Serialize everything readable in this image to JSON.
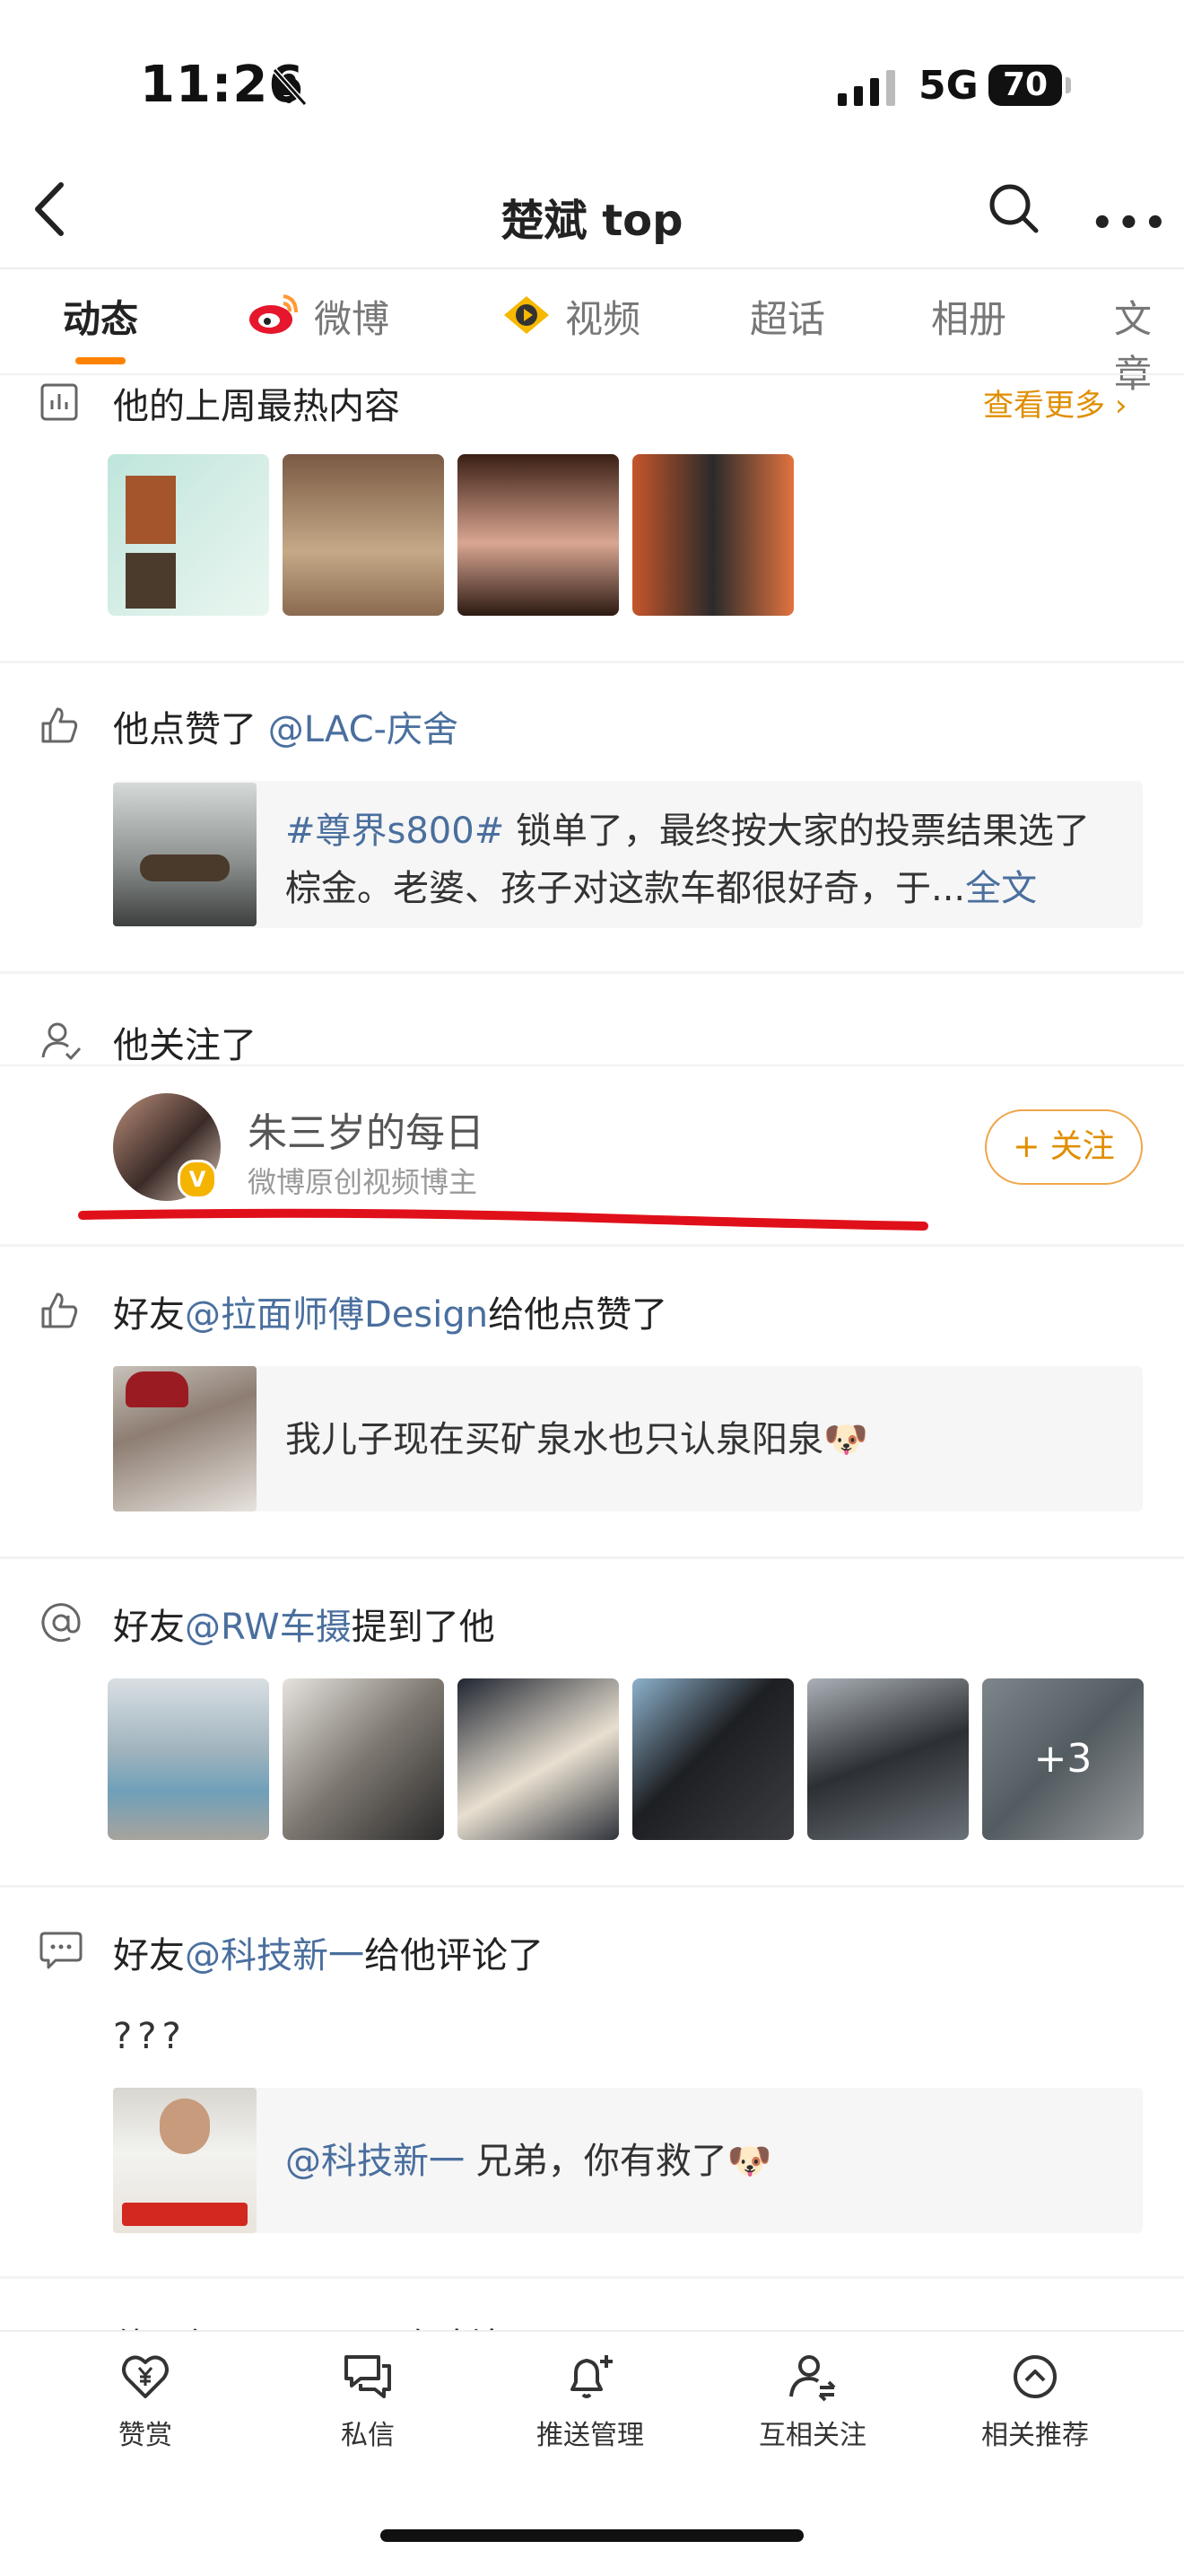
{
  "status_bar": {
    "time": "11:26",
    "network": "5G",
    "battery": "70"
  },
  "nav": {
    "title": "楚斌 top"
  },
  "tabs": [
    "动态",
    "微博",
    "视频",
    "超话",
    "相册",
    "文章"
  ],
  "weekly_hot": {
    "title": "他的上周最热内容",
    "more": "查看更多"
  },
  "like": {
    "prefix": "他点赞了",
    "user": "@LAC-庆舍",
    "tag": "#尊界s800#",
    "line1_rest": "锁单了，最终按大家的投票结果选了",
    "line2": "棕金。老婆、孩子对这款车都很好奇，于...",
    "full": "全文"
  },
  "follow": {
    "prefix": "他关注了",
    "name": "朱三岁的每日",
    "desc": "微博原创视频博主",
    "button": "+ 关注"
  },
  "friend_like": {
    "pre": "好友",
    "user": "@拉面师傅Design",
    "post": "给他点赞了",
    "text": "我儿子现在买矿泉水也只认泉阳泉",
    "emoji": "🐶"
  },
  "mention": {
    "pre": "好友",
    "user": "@RW车摄",
    "post": "提到了他",
    "more_count": "+3"
  },
  "comment": {
    "pre": "好友",
    "user": "@科技新一",
    "post": "给他评论了",
    "body": "???",
    "card_user": "@科技新一",
    "card_text": "兄弟，你有救了",
    "emoji": "🐶"
  },
  "partial_row": {
    "text": "他回复了 @LOVE玫瑰塘"
  },
  "bottom_bar": {
    "items": [
      {
        "label": "赞赏",
        "icon": "heart-yuan-icon"
      },
      {
        "label": "私信",
        "icon": "chat-icon"
      },
      {
        "label": "推送管理",
        "icon": "bell-plus-icon"
      },
      {
        "label": "互相关注",
        "icon": "mutual-follow-icon"
      },
      {
        "label": "相关推荐",
        "icon": "up-circle-icon"
      }
    ]
  },
  "colors": {
    "accent": "#ff8200",
    "link": "#4a6f9e",
    "annotation": "#e0101a"
  }
}
